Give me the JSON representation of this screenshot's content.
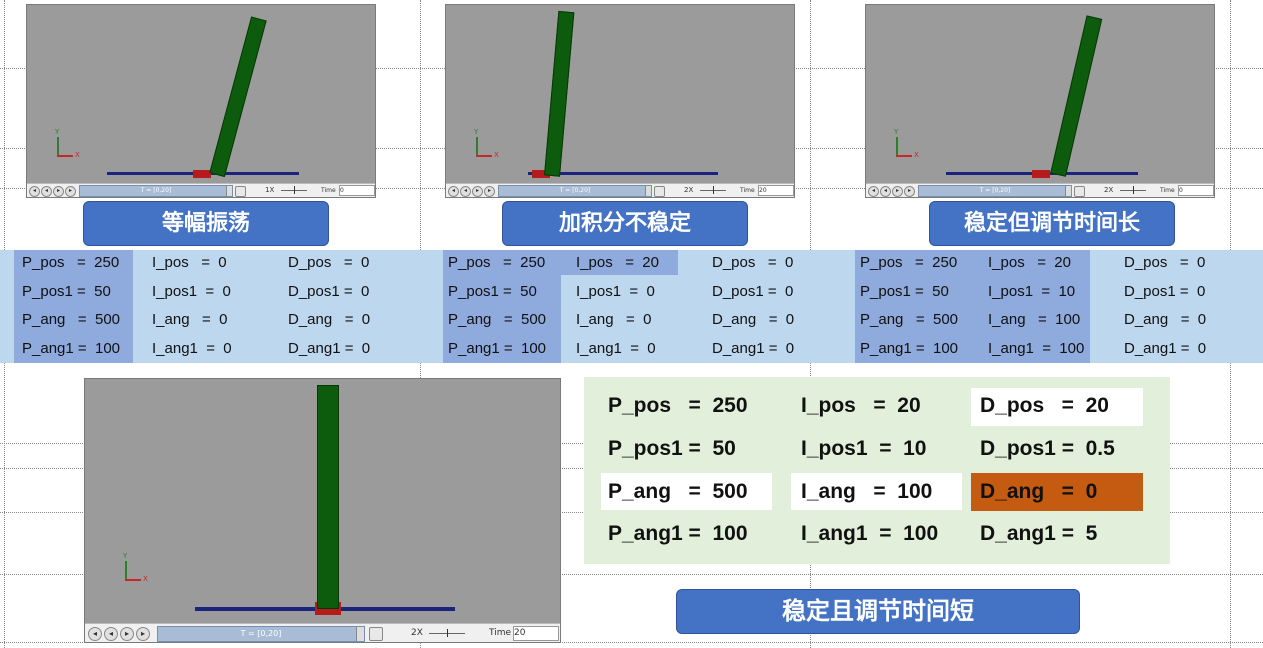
{
  "panels": [
    {
      "time_label": "Time",
      "time_value": "0",
      "speed": "1X",
      "range": "T = [0,20]"
    },
    {
      "time_label": "Time",
      "time_value": "20",
      "speed": "2X",
      "range": "T = [0,20]"
    },
    {
      "time_label": "Time",
      "time_value": "0",
      "speed": "2X",
      "range": "T = [0,20]"
    },
    {
      "time_label": "Time",
      "time_value": "20",
      "speed": "2X",
      "range": "T = [0,20]"
    }
  ],
  "titles": [
    "等幅振荡",
    "加积分不稳定",
    "稳定但调节时间长",
    "稳定且调节时间短"
  ],
  "axis_labels": {
    "y": "Y",
    "x": "X"
  },
  "params": [
    {
      "col1": [
        "P_pos   =  250",
        "P_pos1 =  50",
        "P_ang   =  500",
        "P_ang1 =  100"
      ],
      "col2": [
        "I_pos   =  0",
        "I_pos1  =  0",
        "I_ang   =  0",
        "I_ang1  =  0"
      ],
      "col3": [
        "D_pos   =  0",
        "D_pos1 =  0",
        "D_ang   =  0",
        "D_ang1 =  0"
      ]
    },
    {
      "col1": [
        "P_pos   =  250",
        "P_pos1 =  50",
        "P_ang   =  500",
        "P_ang1 =  100"
      ],
      "col2": [
        "I_pos   =  20",
        "I_pos1  =  0",
        "I_ang   =  0",
        "I_ang1  =  0"
      ],
      "col3": [
        "D_pos   =  0",
        "D_pos1 =  0",
        "D_ang   =  0",
        "D_ang1 =  0"
      ]
    },
    {
      "col1": [
        "P_pos   =  250",
        "P_pos1 =  50",
        "P_ang   =  500",
        "P_ang1 =  100"
      ],
      "col2": [
        "I_pos   =  20",
        "I_pos1  =  10",
        "I_ang   =  100",
        "I_ang1  =  100"
      ],
      "col3": [
        "D_pos   =  0",
        "D_pos1 =  0",
        "D_ang   =  0",
        "D_ang1 =  0"
      ]
    },
    {
      "col1": [
        "P_pos   =  250",
        "P_pos1 =  50",
        "P_ang   =  500",
        "P_ang1 =  100"
      ],
      "col2": [
        "I_pos   =  20",
        "I_pos1  =  10",
        "I_ang   =  100",
        "I_ang1  =  100"
      ],
      "col3": [
        "D_pos   =  20",
        "D_pos1 =  0.5",
        "D_ang   =  0",
        "D_ang1 =  5"
      ]
    }
  ],
  "colors": {
    "title_bg": "#4472c4",
    "band_bg": "#bdd7ee",
    "highlight": "#8faadc",
    "green_box": "#e2efda",
    "orange_highlight": "#c55a11",
    "pole": "#0d5c0d",
    "cart": "#b71c1c",
    "track": "#1a237e"
  }
}
